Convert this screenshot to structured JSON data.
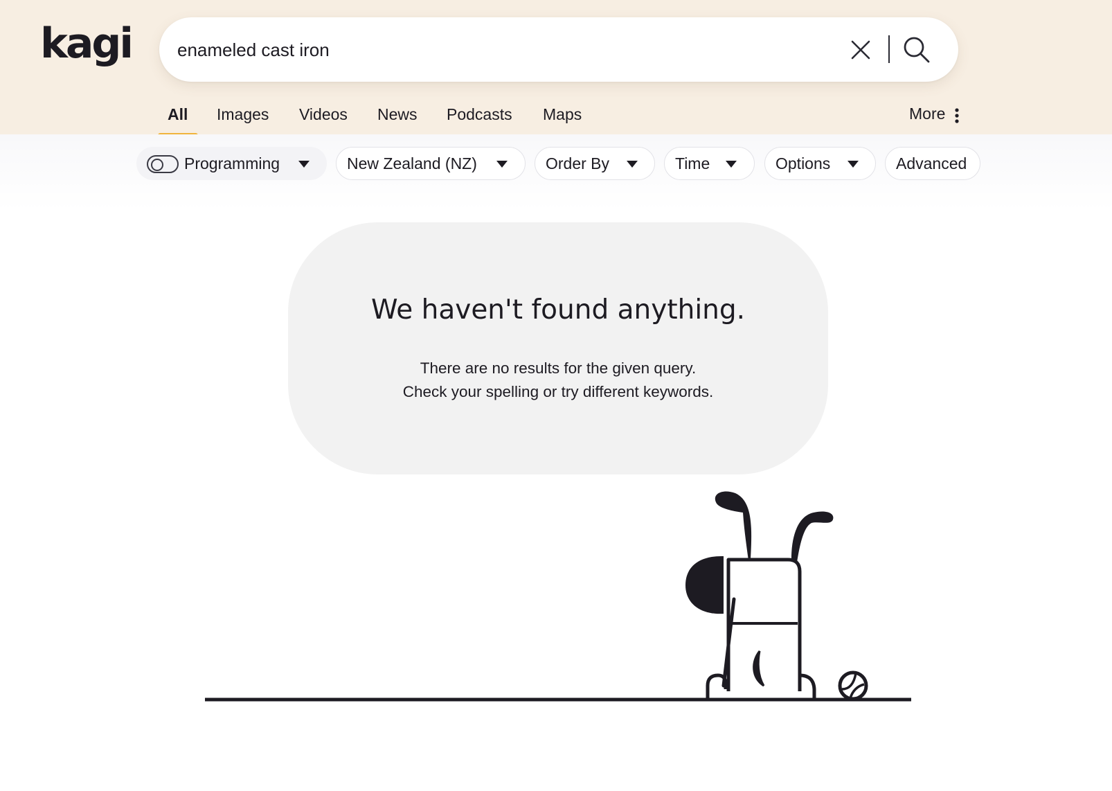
{
  "brand": {
    "logo_text": "kagi"
  },
  "search": {
    "query": "enameled cast iron"
  },
  "tabs": [
    {
      "label": "All",
      "active": true
    },
    {
      "label": "Images"
    },
    {
      "label": "Videos"
    },
    {
      "label": "News"
    },
    {
      "label": "Podcasts"
    },
    {
      "label": "Maps"
    }
  ],
  "more": {
    "label": "More"
  },
  "filters": {
    "lens": {
      "label": "Programming",
      "enabled": false
    },
    "region": {
      "label": "New Zealand (NZ)"
    },
    "order": {
      "label": "Order By"
    },
    "time": {
      "label": "Time"
    },
    "options": {
      "label": "Options"
    },
    "advanced": {
      "label": "Advanced"
    }
  },
  "empty_state": {
    "title": "We haven't found anything.",
    "line1": "There are no results for the given query.",
    "line2": "Check your spelling or try different keywords."
  },
  "colors": {
    "header_bg": "#f7eee2",
    "accent": "#f0b43c",
    "text": "#1d1b22",
    "card_bg": "#f2f2f2"
  },
  "icons": {
    "clear": "close-icon",
    "search": "search-icon",
    "more": "kebab-menu-icon",
    "dropdown": "caret-down-icon",
    "illustration": "dog-headstand-illustration"
  }
}
